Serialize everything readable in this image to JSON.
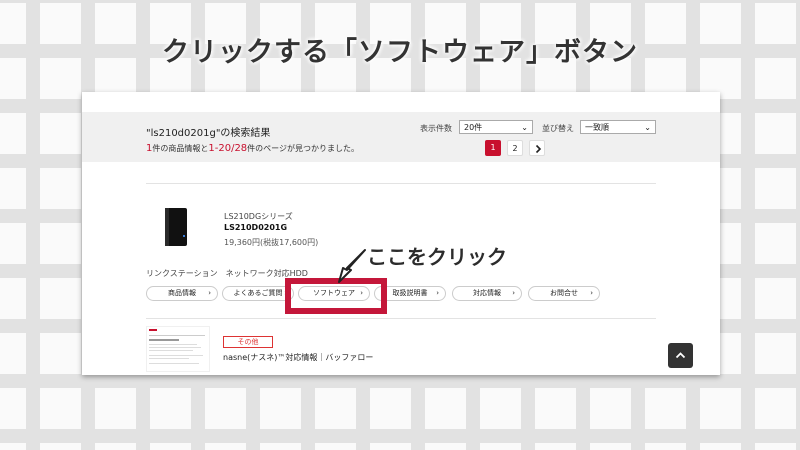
{
  "headline": "クリックする「ソフトウェア」ボタン",
  "search": {
    "title": "\"ls210d0201g\"の検索結果",
    "summary": {
      "product_count": "1",
      "product_text": "件の商品情報と",
      "page_range": "1-20/28",
      "page_text": "件のページが見つかりました。"
    },
    "per_page_label": "表示件数",
    "per_page_value": "20件",
    "sort_label": "並び替え",
    "sort_value": "一致順",
    "pages": [
      "1",
      "2"
    ],
    "next_icon": "chevron-right-icon"
  },
  "product": {
    "series": "LS210DGシリーズ",
    "model": "LS210D0201G",
    "price": "19,360円(税抜17,600円)",
    "tags": "リンクステーション　ネットワーク対応HDD"
  },
  "actions": [
    {
      "label": "商品情報"
    },
    {
      "label": "よくあるご質問"
    },
    {
      "label": "ソフトウェア"
    },
    {
      "label": "取扱説明書"
    },
    {
      "label": "対応情報"
    },
    {
      "label": "お問合せ"
    }
  ],
  "related": {
    "category": "その他",
    "title": "nasne(ナスネ)™対応情報｜バッファロー"
  },
  "annotation": "ここをクリック",
  "colors": {
    "accent": "#c8102e",
    "highlight_box": "#c4173a"
  }
}
